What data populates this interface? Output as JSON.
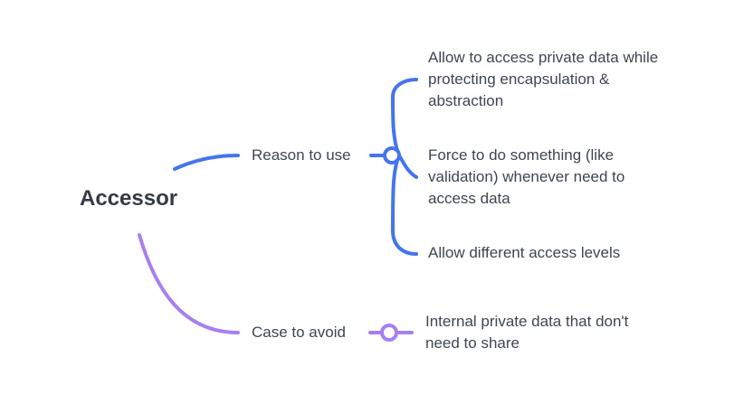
{
  "root": {
    "label": "Accessor"
  },
  "branches": [
    {
      "label": "Reason to use",
      "children": [
        "Allow to access private data while\nprotecting encapsulation &\nabstraction",
        "Force to do something (like\nvalidation) whenever need to\naccess data",
        "Allow different access levels"
      ]
    },
    {
      "label": "Case to avoid",
      "children": [
        "Internal private data that don't\nneed to share"
      ]
    }
  ],
  "colors": {
    "blue_branch": "#4474ee",
    "purple_branch": "#a77ff0",
    "text": "#3f4650",
    "root_text": "#343b45"
  }
}
